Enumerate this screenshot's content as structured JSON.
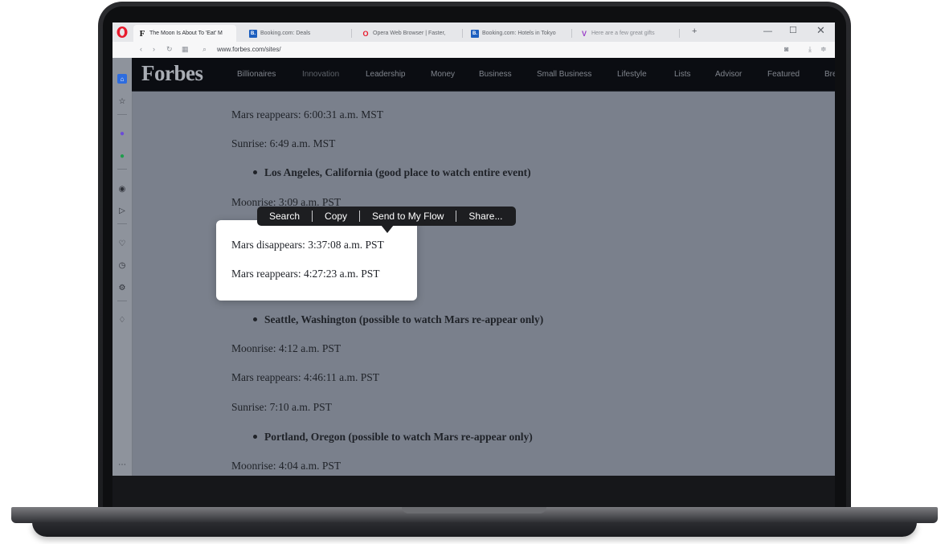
{
  "browser": {
    "tabs": [
      {
        "label": "The Moon Is About To 'Eat' M",
        "favicon": "F",
        "active": true
      },
      {
        "label": "Booking.com: Deals",
        "favicon": "B."
      },
      {
        "label": "Opera Web Browser | Faster,",
        "favicon": "O"
      },
      {
        "label": "Booking.com: Hotels in Tokyo",
        "favicon": "B."
      },
      {
        "label": "Here are a few great gifts",
        "favicon": "V"
      }
    ],
    "new_tab_label": "+",
    "url": "www.forbes.com/sites/"
  },
  "forbes": {
    "logo": "Forbes",
    "nav": [
      "Billionaires",
      "Innovation",
      "Leadership",
      "Money",
      "Business",
      "Small Business",
      "Lifestyle",
      "Lists",
      "Advisor",
      "Featured",
      "Bre"
    ]
  },
  "article": {
    "l1": "Mars reappears: 6:00:31 a.m. MST",
    "l2": "Sunrise: 6:49 a.m. MST",
    "b1": "Los Angeles, California (good place to watch entire event)",
    "l3": "Moonrise: 3:09 a.m. PST",
    "l4": "Mars disappears: 3:37:08 a.m. PST",
    "l5": "Mars reappears: 4:27:23 a.m. PST",
    "b2": "Seattle, Washington (possible to watch Mars re-appear only)",
    "l6": "Moonrise: 4:12 a.m. PST",
    "l7": "Mars reappears: 4:46:11 a.m. PST",
    "l8": "Sunrise: 7:10 a.m. PST",
    "b3": "Portland, Oregon (possible to watch Mars re-appear only)",
    "l9": "Moonrise: 4:04 a.m. PST"
  },
  "context_menu": {
    "search": "Search",
    "copy": "Copy",
    "send": "Send to My Flow",
    "share": "Share..."
  },
  "colors": {
    "accent": "#e8192c",
    "booking": "#1d5fbf",
    "vpn": "#9b3fc9"
  }
}
